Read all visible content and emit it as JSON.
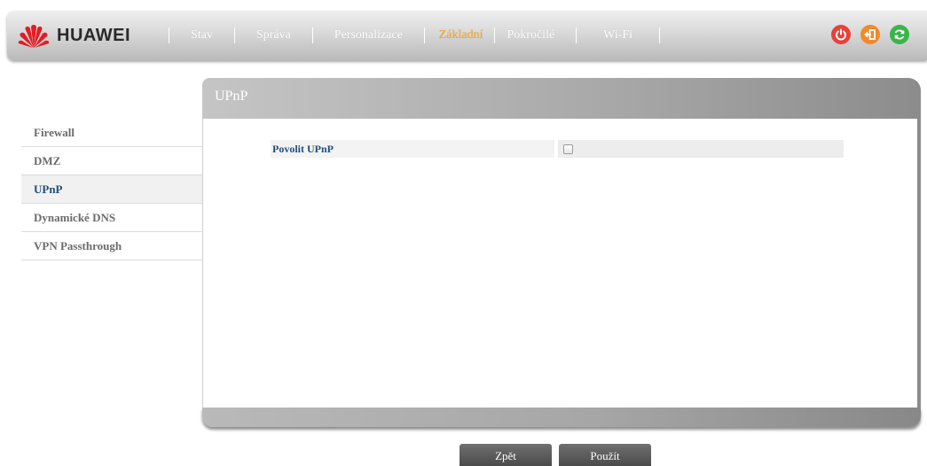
{
  "brand": {
    "name": "HUAWEI"
  },
  "nav": {
    "items": [
      {
        "label": "Stav",
        "active": false
      },
      {
        "label": "Správa",
        "active": false
      },
      {
        "label": "Personalizace",
        "active": false
      },
      {
        "label": "Základní",
        "active": true
      },
      {
        "label": "Pokročilé",
        "active": false
      },
      {
        "label": "Wi-Fi",
        "active": false
      }
    ]
  },
  "top_icons": [
    {
      "name": "power-icon",
      "color": "#e8413a"
    },
    {
      "name": "logout-icon",
      "color": "#f08a2a"
    },
    {
      "name": "refresh-icon",
      "color": "#3bb44a"
    }
  ],
  "sidebar": {
    "items": [
      {
        "label": "Firewall",
        "active": false
      },
      {
        "label": "DMZ",
        "active": false
      },
      {
        "label": "UPnP",
        "active": true
      },
      {
        "label": "Dynamické DNS",
        "active": false
      },
      {
        "label": "VPN Passthrough",
        "active": false
      }
    ]
  },
  "panel": {
    "title": "UPnP",
    "fields": [
      {
        "label": "Povolit UPnP",
        "checked": false
      }
    ]
  },
  "buttons": {
    "back": "Zpět",
    "apply": "Použít"
  },
  "colors": {
    "accent_active_nav": "#f5a623",
    "sidebar_active_text": "#1f4f7d"
  }
}
